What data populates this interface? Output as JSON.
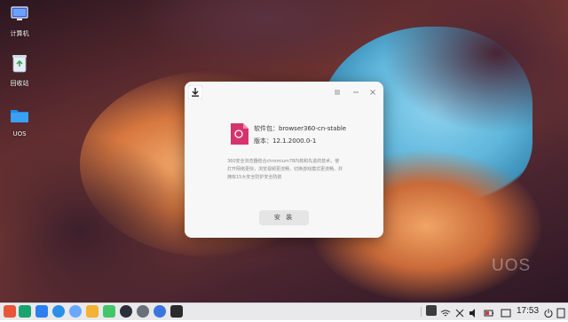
{
  "desktop": {
    "icons": [
      {
        "label": "计算机",
        "icon": "computer-icon"
      },
      {
        "label": "回收站",
        "icon": "trash-icon"
      },
      {
        "label": "UOS",
        "icon": "folder-icon"
      }
    ],
    "watermark": "UOS"
  },
  "dialog": {
    "package_label": "软件包：",
    "package_value": "browser360-cn-stable",
    "version_label": "版本：",
    "version_value": "12.1.2000.0-1",
    "description": "360安全浏览器结合chromium78内核和先进的技术。使打开网络更快，浏览视频更流畅，切换游戏模式更流畅。并拥有15大安全防护安全防航",
    "install_label": "安 装",
    "package_icon_text": "debian",
    "accent_color": "#d6336c"
  },
  "taskbar": {
    "clock": "17:53",
    "apps": [
      "launcher-icon",
      "multitask-icon",
      "file-manager-icon",
      "store-icon",
      "browser-icon",
      "music-icon",
      "video-icon",
      "app-store-icon",
      "settings-icon",
      "terminal-icon"
    ]
  }
}
